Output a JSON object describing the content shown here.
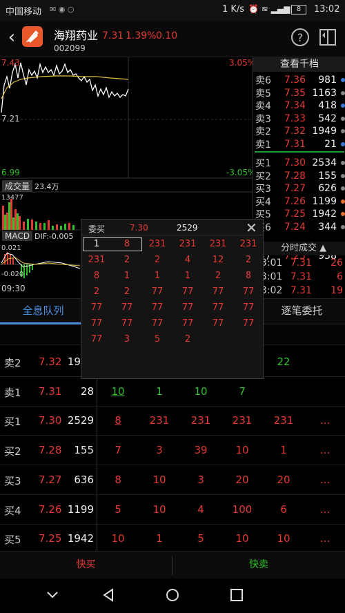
{
  "status": {
    "carrier": "中国移动",
    "speed": "1 K/s",
    "battery": "8",
    "time": "13:02"
  },
  "header": {
    "name": "海翔药业",
    "code": "002099",
    "price": "7.31",
    "pct": "1.39%",
    "change": "0.10"
  },
  "chart": {
    "price_top": "7.43",
    "pct_top": "3.05%",
    "price_mid": "7.21",
    "price_bottom": "6.99",
    "pct_bottom": "-3.05%",
    "volume_label": "成交量",
    "volume_value": "23.4万",
    "volume_max": "13477",
    "macd_label": "MACD",
    "macd_dif": "DIF:-0.005",
    "macd_top": "0.021",
    "macd_bottom": "-0.020",
    "time_start": "09:30"
  },
  "book": {
    "title": "查看千档",
    "asks": [
      {
        "label": "卖6",
        "price": "7.36",
        "vol": "981",
        "dot": "#3a7bd5"
      },
      {
        "label": "卖5",
        "price": "7.35",
        "vol": "1163",
        "dot": "#888888"
      },
      {
        "label": "卖4",
        "price": "7.34",
        "vol": "418",
        "dot": "#3a7bd5"
      },
      {
        "label": "卖3",
        "price": "7.33",
        "vol": "542",
        "dot": "#888888"
      },
      {
        "label": "卖2",
        "price": "7.32",
        "vol": "1949",
        "dot": "#888888"
      },
      {
        "label": "卖1",
        "price": "7.31",
        "vol": "21",
        "dot": "#3a7bd5"
      }
    ],
    "bids": [
      {
        "label": "买1",
        "price": "7.30",
        "vol": "2534",
        "dot": "#888888"
      },
      {
        "label": "买2",
        "price": "7.28",
        "vol": "155",
        "dot": "#888888"
      },
      {
        "label": "买3",
        "price": "7.27",
        "vol": "626",
        "dot": "#888888"
      },
      {
        "label": "买4",
        "price": "7.26",
        "vol": "1199",
        "dot": "#e87030"
      },
      {
        "label": "买5",
        "price": "7.25",
        "vol": "1942",
        "dot": "#e87030"
      },
      {
        "label": "买6",
        "price": "7.24",
        "vol": "344",
        "dot": "#888888"
      }
    ],
    "partial_label": "买7",
    "partial_price": "7.23",
    "partial_vol": "958",
    "trades_title": "分时成交",
    "trades": [
      {
        "time": "13:01",
        "price": "7.31",
        "vol": "26"
      },
      {
        "time": "13:01",
        "price": "7.31",
        "vol": "6"
      },
      {
        "time": "13:02",
        "price": "7.31",
        "vol": "19"
      }
    ]
  },
  "tabs": {
    "left": "全息队列",
    "right": "逐笔委托"
  },
  "queue": [
    {
      "side": "卖2",
      "price": "7.32",
      "vol": "1949",
      "cells": [
        "",
        "",
        "",
        "",
        "22",
        ""
      ],
      "cell_colors": [
        "red",
        "red",
        "red",
        "red",
        "green",
        "red"
      ]
    },
    {
      "side": "卖1",
      "price": "7.31",
      "vol": "28",
      "cells": [
        "10",
        "1",
        "10",
        "7",
        "",
        ""
      ],
      "cell_colors": [
        "green",
        "green",
        "green",
        "green",
        "green",
        "green"
      ]
    },
    {
      "side": "买1",
      "price": "7.30",
      "vol": "2529",
      "cells": [
        "8",
        "231",
        "231",
        "231",
        "231",
        "..."
      ],
      "cell_colors": [
        "red",
        "red",
        "red",
        "red",
        "red",
        "red"
      ]
    },
    {
      "side": "买2",
      "price": "7.28",
      "vol": "155",
      "cells": [
        "7",
        "3",
        "39",
        "10",
        "1",
        "..."
      ],
      "cell_colors": [
        "red",
        "red",
        "red",
        "red",
        "red",
        "red"
      ]
    },
    {
      "side": "买3",
      "price": "7.27",
      "vol": "636",
      "cells": [
        "8",
        "10",
        "3",
        "20",
        "20",
        "..."
      ],
      "cell_colors": [
        "red",
        "red",
        "red",
        "red",
        "red",
        "red"
      ]
    },
    {
      "side": "买4",
      "price": "7.26",
      "vol": "1199",
      "cells": [
        "5",
        "10",
        "4",
        "100",
        "6",
        "..."
      ],
      "cell_colors": [
        "red",
        "red",
        "red",
        "red",
        "red",
        "red"
      ]
    },
    {
      "side": "买5",
      "price": "7.25",
      "vol": "1942",
      "cells": [
        "10",
        "1",
        "5",
        "10",
        "10",
        "..."
      ],
      "cell_colors": [
        "red",
        "red",
        "red",
        "red",
        "red",
        "red"
      ]
    }
  ],
  "popup": {
    "title": "委买",
    "price": "7.30",
    "total": "2529",
    "rows": [
      [
        "1",
        "8",
        "231",
        "231",
        "231",
        "231"
      ],
      [
        "231",
        "2",
        "2",
        "4",
        "12",
        "2"
      ],
      [
        "8",
        "1",
        "1",
        "1",
        "2",
        "8"
      ],
      [
        "2",
        "2",
        "77",
        "77",
        "77",
        "77"
      ],
      [
        "77",
        "77",
        "77",
        "77",
        "77",
        "77"
      ],
      [
        "77",
        "77",
        "77",
        "77",
        "77",
        "77"
      ],
      [
        "77",
        "3",
        "5",
        "2"
      ]
    ]
  },
  "bottom": {
    "buy": "快买",
    "sell": "快卖"
  }
}
